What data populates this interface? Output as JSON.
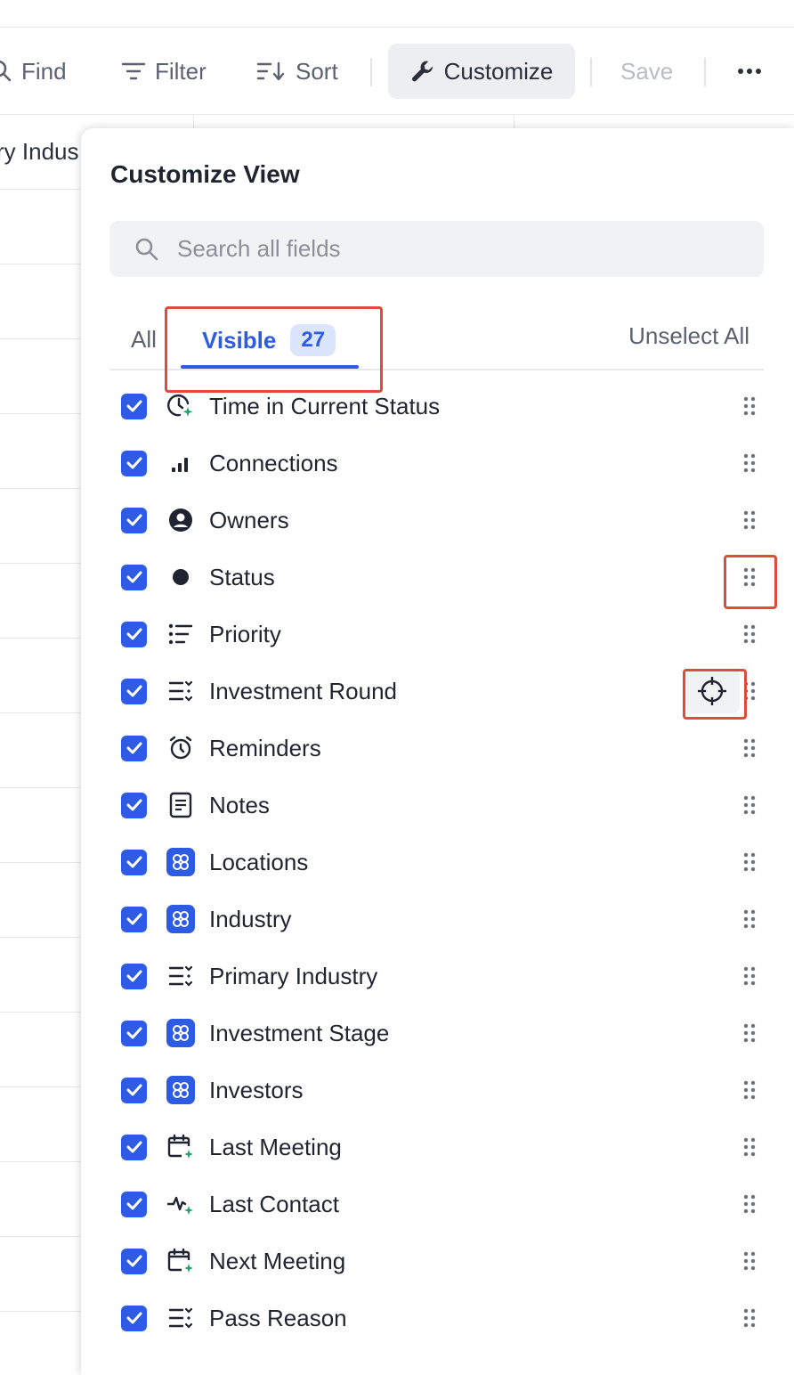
{
  "toolbar": {
    "find_label": "Find",
    "filter_label": "Filter",
    "sort_label": "Sort",
    "customize_label": "Customize",
    "save_label": "Save"
  },
  "table": {
    "partial_column_header": "ry Indus"
  },
  "panel": {
    "title": "Customize View",
    "search_placeholder": "Search all fields",
    "tab_all": "All",
    "tab_visible": "Visible",
    "visible_count": "27",
    "unselect_all": "Unselect All"
  },
  "colors": {
    "accent": "#2d5be3",
    "highlight": "#e24b3b",
    "ai_sparkle": "#23a06a"
  },
  "fields": [
    {
      "label": "Time in Current Status",
      "icon": "clock-sparkle-icon",
      "checked": true
    },
    {
      "label": "Connections",
      "icon": "signal-bars-icon",
      "checked": true
    },
    {
      "label": "Owners",
      "icon": "user-circle-icon",
      "checked": true
    },
    {
      "label": "Status",
      "icon": "dot-icon",
      "checked": true
    },
    {
      "label": "Priority",
      "icon": "list-icon",
      "checked": true
    },
    {
      "label": "Investment Round",
      "icon": "select-list-icon",
      "checked": true
    },
    {
      "label": "Reminders",
      "icon": "alarm-clock-icon",
      "checked": true
    },
    {
      "label": "Notes",
      "icon": "note-icon",
      "checked": true
    },
    {
      "label": "Locations",
      "icon": "grid-badge-icon",
      "checked": true
    },
    {
      "label": "Industry",
      "icon": "grid-badge-icon",
      "checked": true
    },
    {
      "label": "Primary Industry",
      "icon": "select-list-icon",
      "checked": true
    },
    {
      "label": "Investment Stage",
      "icon": "grid-badge-icon",
      "checked": true
    },
    {
      "label": "Investors",
      "icon": "grid-badge-icon",
      "checked": true
    },
    {
      "label": "Last Meeting",
      "icon": "calendar-sparkle-icon",
      "checked": true
    },
    {
      "label": "Last Contact",
      "icon": "activity-sparkle-icon",
      "checked": true
    },
    {
      "label": "Next Meeting",
      "icon": "calendar-sparkle-icon",
      "checked": true
    },
    {
      "label": "Pass Reason",
      "icon": "select-list-icon",
      "checked": true
    }
  ]
}
